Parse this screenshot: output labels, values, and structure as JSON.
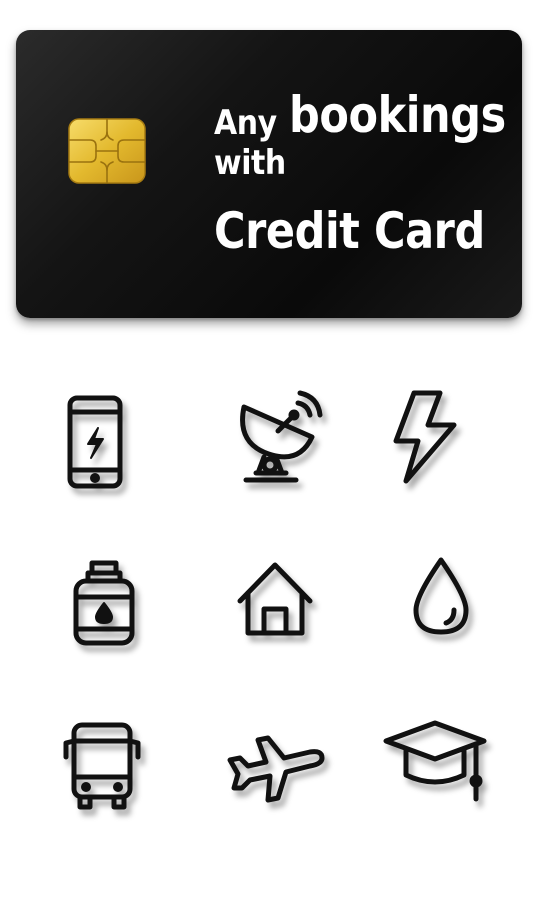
{
  "card": {
    "line1_small": "Any",
    "line1_big": "bookings",
    "line2": "with",
    "line3": "Credit Card"
  },
  "icons": [
    "phone-recharge-icon",
    "satellite-dish-icon",
    "lightning-bolt-icon",
    "gas-cylinder-icon",
    "house-icon",
    "water-drop-icon",
    "bus-icon",
    "airplane-icon",
    "graduation-cap-icon"
  ],
  "colors": {
    "card_background": "#0f0f0f",
    "chip_gold": "#e3b92e",
    "text": "#ffffff",
    "icon_stroke": "#111111"
  }
}
